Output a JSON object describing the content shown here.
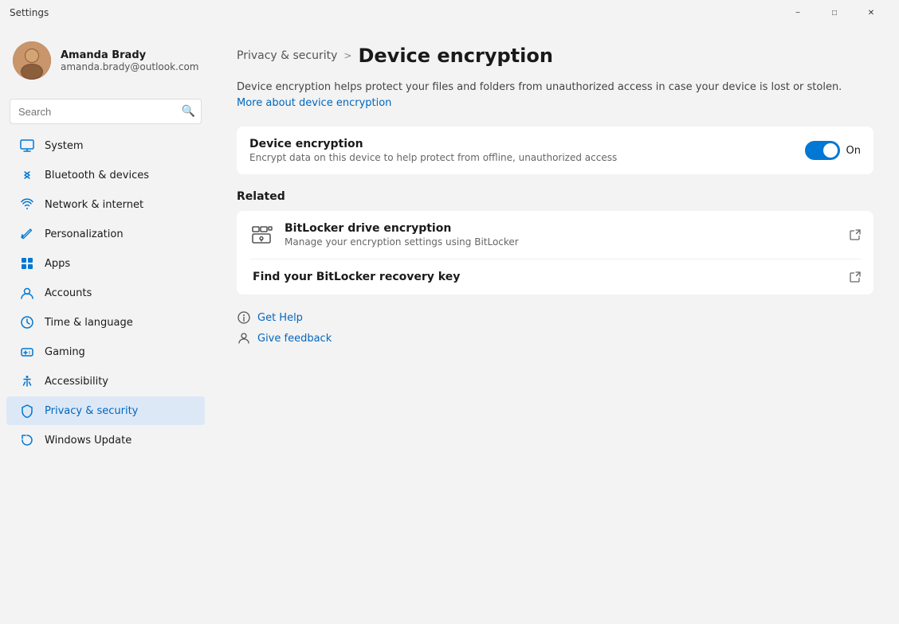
{
  "window": {
    "title": "Settings",
    "minimize_label": "−",
    "maximize_label": "□",
    "close_label": "✕"
  },
  "user": {
    "name": "Amanda Brady",
    "email": "amanda.brady@outlook.com"
  },
  "search": {
    "placeholder": "Search"
  },
  "nav": {
    "items": [
      {
        "id": "system",
        "label": "System",
        "icon": "system"
      },
      {
        "id": "bluetooth",
        "label": "Bluetooth & devices",
        "icon": "bluetooth"
      },
      {
        "id": "network",
        "label": "Network & internet",
        "icon": "network"
      },
      {
        "id": "personalization",
        "label": "Personalization",
        "icon": "personalization"
      },
      {
        "id": "apps",
        "label": "Apps",
        "icon": "apps"
      },
      {
        "id": "accounts",
        "label": "Accounts",
        "icon": "accounts"
      },
      {
        "id": "time",
        "label": "Time & language",
        "icon": "time"
      },
      {
        "id": "gaming",
        "label": "Gaming",
        "icon": "gaming"
      },
      {
        "id": "accessibility",
        "label": "Accessibility",
        "icon": "accessibility"
      },
      {
        "id": "privacy",
        "label": "Privacy & security",
        "icon": "privacy",
        "active": true
      },
      {
        "id": "update",
        "label": "Windows Update",
        "icon": "update"
      }
    ]
  },
  "breadcrumb": {
    "parent": "Privacy & security",
    "separator": ">",
    "current": "Device encryption"
  },
  "description": {
    "text": "Device encryption helps protect your files and folders from unauthorized access in case your device is lost or stolen.",
    "link_text": "More about device encryption",
    "link_href": "#"
  },
  "device_encryption": {
    "title": "Device encryption",
    "description": "Encrypt data on this device to help protect from offline, unauthorized access",
    "toggle_state": true,
    "toggle_label": "On"
  },
  "related": {
    "section_title": "Related",
    "items": [
      {
        "id": "bitlocker",
        "title": "BitLocker drive encryption",
        "description": "Manage your encryption settings using BitLocker",
        "has_icon": true
      },
      {
        "id": "recovery-key",
        "title": "Find your BitLocker recovery key",
        "description": "",
        "has_icon": false
      }
    ]
  },
  "help": {
    "get_help_label": "Get Help",
    "give_feedback_label": "Give feedback"
  }
}
